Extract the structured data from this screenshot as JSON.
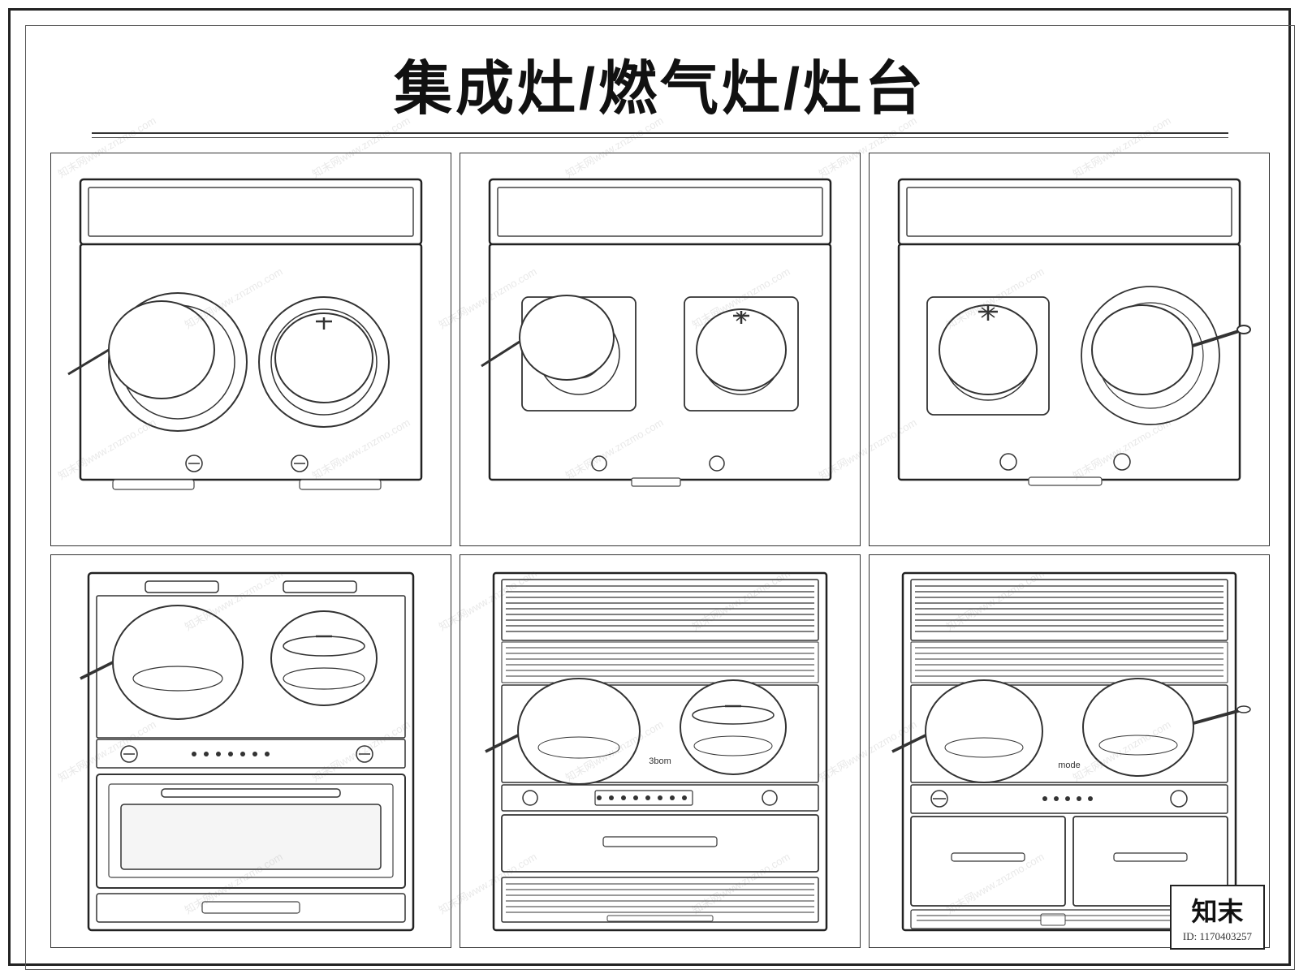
{
  "title": "集成灶/燃气灶/灶台",
  "watermark_text": "www.znzmo.com",
  "logo": {
    "name": "知末",
    "id_label": "ID: 1170403257"
  },
  "appliances": [
    {
      "id": "top-left",
      "type": "gas-stove-top-view-1"
    },
    {
      "id": "top-center",
      "type": "gas-stove-top-view-2"
    },
    {
      "id": "top-right",
      "type": "gas-stove-top-view-3"
    },
    {
      "id": "bottom-left",
      "type": "integrated-stove-front-1"
    },
    {
      "id": "bottom-center",
      "type": "integrated-stove-front-2"
    },
    {
      "id": "bottom-right",
      "type": "integrated-stove-front-3"
    }
  ]
}
